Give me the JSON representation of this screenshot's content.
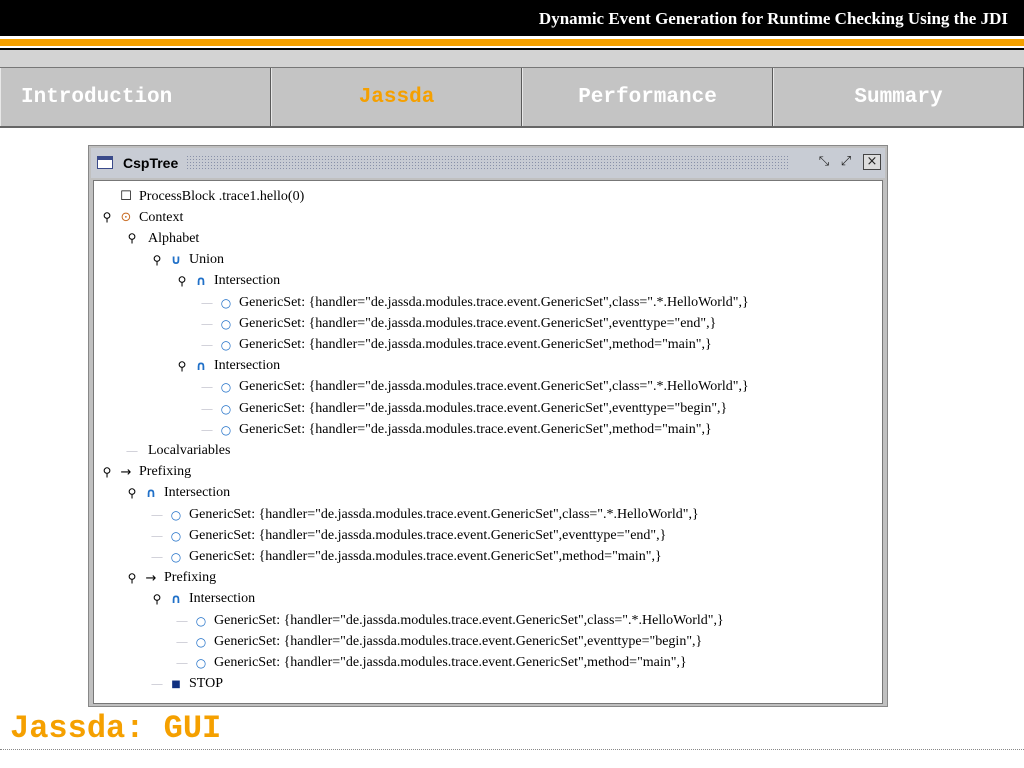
{
  "header": {
    "title": "Dynamic Event Generation for Runtime Checking Using the JDI"
  },
  "nav": {
    "tabs": [
      {
        "label": "Introduction",
        "active": false
      },
      {
        "label": "Jassda",
        "active": true
      },
      {
        "label": "Performance",
        "active": false
      },
      {
        "label": "Summary",
        "active": false
      }
    ]
  },
  "window": {
    "title": "CspTree",
    "buttons": [
      "restore-icon",
      "maximize-icon",
      "close-icon"
    ]
  },
  "tree": {
    "nodes": [
      {
        "label": "ProcessBlock .trace1.hello(0)",
        "icon": "checkbox-icon"
      },
      {
        "label": "Context",
        "icon": "context-icon"
      },
      {
        "label": "Alphabet",
        "icon": "none"
      },
      {
        "label": "Union",
        "icon": "union-icon"
      },
      {
        "label": "Intersection",
        "icon": "intersection-icon"
      },
      {
        "label": "GenericSet: {handler=\"de.jassda.modules.trace.event.GenericSet\",class=\".*.HelloWorld\",}",
        "icon": "leaf-icon"
      },
      {
        "label": "GenericSet: {handler=\"de.jassda.modules.trace.event.GenericSet\",eventtype=\"end\",}",
        "icon": "leaf-icon"
      },
      {
        "label": "GenericSet: {handler=\"de.jassda.modules.trace.event.GenericSet\",method=\"main\",}",
        "icon": "leaf-icon"
      },
      {
        "label": "Intersection",
        "icon": "intersection-icon"
      },
      {
        "label": "GenericSet: {handler=\"de.jassda.modules.trace.event.GenericSet\",class=\".*.HelloWorld\",}",
        "icon": "leaf-icon"
      },
      {
        "label": "GenericSet: {handler=\"de.jassda.modules.trace.event.GenericSet\",eventtype=\"begin\",}",
        "icon": "leaf-icon"
      },
      {
        "label": "GenericSet: {handler=\"de.jassda.modules.trace.event.GenericSet\",method=\"main\",}",
        "icon": "leaf-icon"
      },
      {
        "label": "Localvariables",
        "icon": "none"
      },
      {
        "label": "Prefixing",
        "icon": "arrow-icon"
      },
      {
        "label": "Intersection",
        "icon": "intersection-icon"
      },
      {
        "label": "GenericSet: {handler=\"de.jassda.modules.trace.event.GenericSet\",class=\".*.HelloWorld\",}",
        "icon": "leaf-icon"
      },
      {
        "label": "GenericSet: {handler=\"de.jassda.modules.trace.event.GenericSet\",eventtype=\"end\",}",
        "icon": "leaf-icon"
      },
      {
        "label": "GenericSet: {handler=\"de.jassda.modules.trace.event.GenericSet\",method=\"main\",}",
        "icon": "leaf-icon"
      },
      {
        "label": "Prefixing",
        "icon": "arrow-icon"
      },
      {
        "label": "Intersection",
        "icon": "intersection-icon"
      },
      {
        "label": "GenericSet: {handler=\"de.jassda.modules.trace.event.GenericSet\",class=\".*.HelloWorld\",}",
        "icon": "leaf-icon"
      },
      {
        "label": "GenericSet: {handler=\"de.jassda.modules.trace.event.GenericSet\",eventtype=\"begin\",}",
        "icon": "leaf-icon"
      },
      {
        "label": "GenericSet: {handler=\"de.jassda.modules.trace.event.GenericSet\",method=\"main\",}",
        "icon": "leaf-icon"
      },
      {
        "label": "STOP",
        "icon": "stop-icon"
      }
    ]
  },
  "footer": {
    "title": "Jassda: GUI"
  },
  "colors": {
    "accent": "#f5a000",
    "header_bg": "#000000",
    "nav_bg": "#c4c4c4"
  }
}
